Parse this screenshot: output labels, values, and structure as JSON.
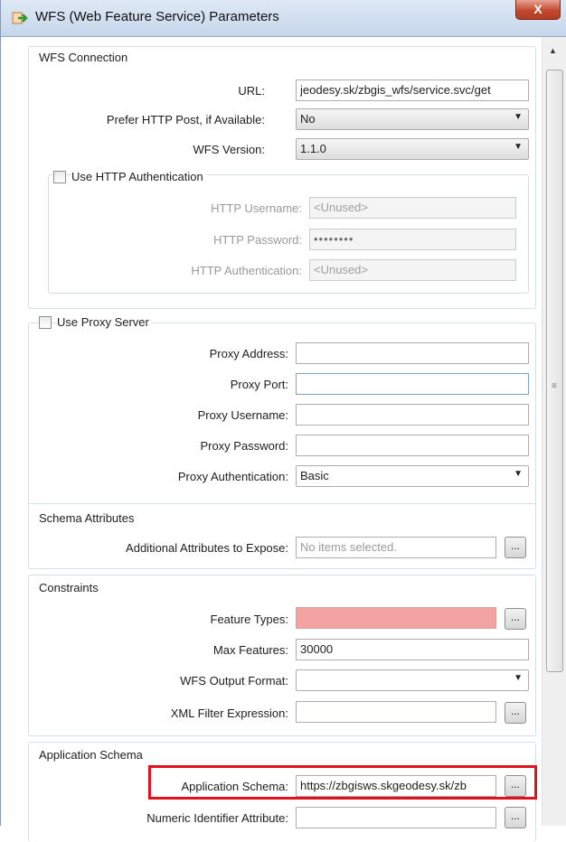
{
  "window": {
    "title": "WFS (Web Feature Service) Parameters",
    "close_glyph": "X"
  },
  "wfs_connection": {
    "title": "WFS Connection",
    "url_label": "URL:",
    "url_value": "jeodesy.sk/zbgis_wfs/service.svc/get",
    "prefer_post_label": "Prefer HTTP Post, if Available:",
    "prefer_post_value": "No",
    "version_label": "WFS Version:",
    "version_value": "1.1.0",
    "http_auth": {
      "checkbox_label": "Use HTTP Authentication",
      "username_label": "HTTP Username:",
      "username_value": "<Unused>",
      "password_label": "HTTP Password:",
      "password_value": "••••••••",
      "auth_label": "HTTP Authentication:",
      "auth_value": "<Unused>"
    }
  },
  "proxy": {
    "checkbox_label": "Use Proxy Server",
    "address_label": "Proxy Address:",
    "port_label": "Proxy Port:",
    "username_label": "Proxy Username:",
    "password_label": "Proxy Password:",
    "auth_label": "Proxy Authentication:",
    "auth_value": "Basic"
  },
  "schema_attributes": {
    "title": "Schema Attributes",
    "additional_label": "Additional Attributes to Expose:",
    "additional_placeholder": "No items selected."
  },
  "constraints": {
    "title": "Constraints",
    "feature_types_label": "Feature Types:",
    "max_features_label": "Max Features:",
    "max_features_value": "30000",
    "output_format_label": "WFS Output Format:",
    "xml_filter_label": "XML Filter Expression:"
  },
  "application_schema": {
    "title": "Application Schema",
    "schema_label": "Application Schema:",
    "schema_value": "https://zbgisws.skgeodesy.sk/zb",
    "numeric_id_label": "Numeric Identifier Attribute:"
  },
  "ellipsis_label": "...",
  "dropdown_arrow": "▼",
  "scroll_up_arrow": "▲",
  "grip_glyph": "≡",
  "colors": {
    "highlight_border": "#e0121e",
    "required_field": "#f4a3a3",
    "close_button": "#c24a32"
  }
}
